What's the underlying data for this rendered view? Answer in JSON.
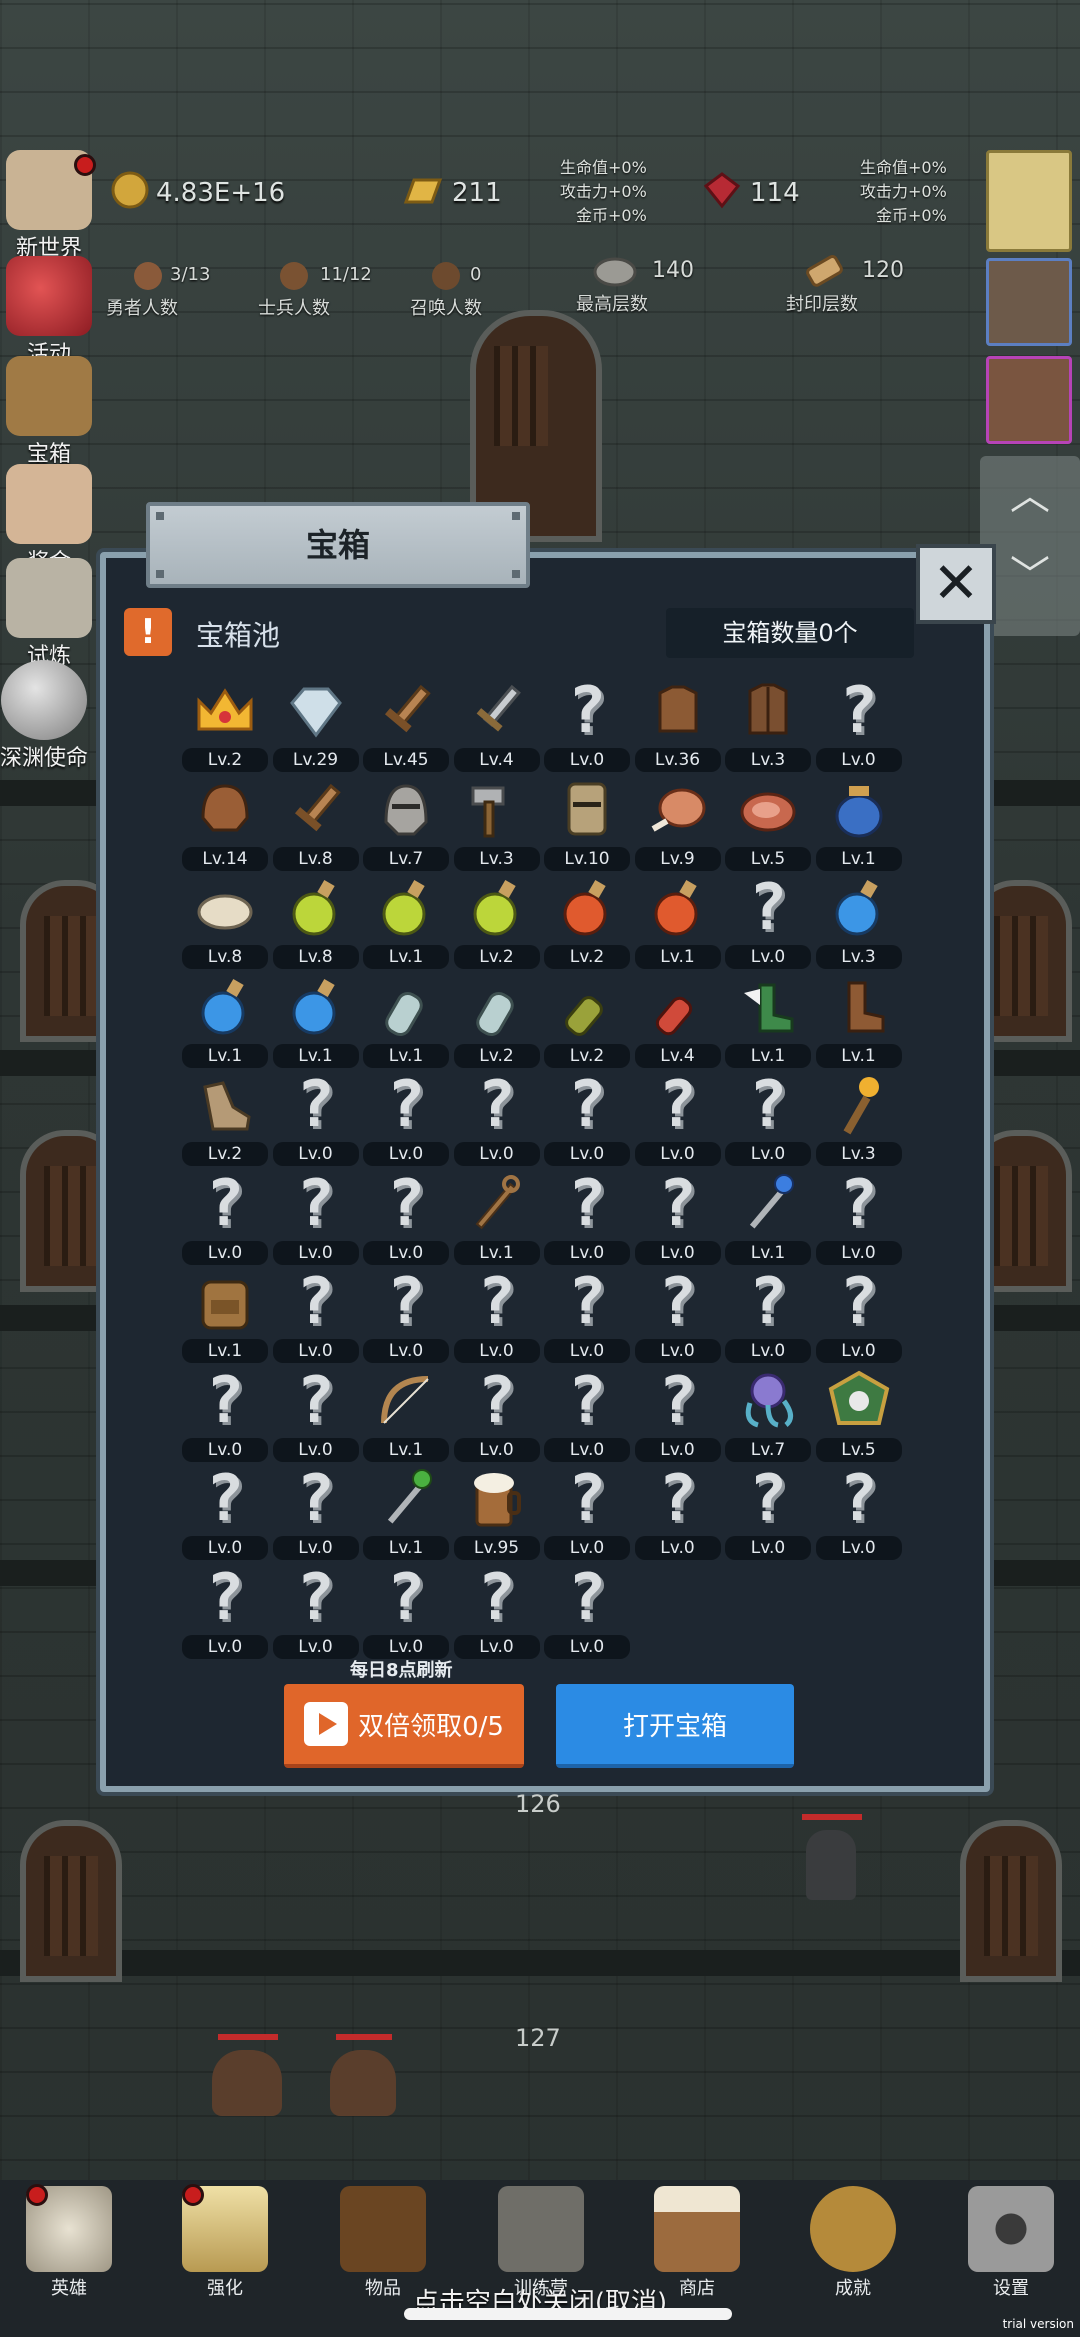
{
  "top": {
    "gold": "4.83E+16",
    "gold_bar": "211",
    "gem": "114",
    "hero_count": "3/13",
    "hero_label": "勇者人数",
    "soldier_count": "11/12",
    "soldier_label": "士兵人数",
    "summon_count": "0",
    "summon_label": "召唤人数",
    "max_floor": "140",
    "max_floor_label": "最高层数",
    "seal_floor": "120",
    "seal_floor_label": "封印层数",
    "bonus_left": [
      "生命值+0%",
      "攻击力+0%",
      "金币+0%"
    ],
    "bonus_right": [
      "生命值+0%",
      "攻击力+0%",
      "金币+0%"
    ]
  },
  "side_menu": [
    "新世界",
    "活动",
    "宝箱",
    "奖金",
    "试炼",
    "深渊使命"
  ],
  "modal": {
    "title": "宝箱",
    "close": "✕",
    "pool_label": "宝箱池",
    "chest_count": "宝箱数量0个",
    "refresh_note": "每日8点刷新",
    "double_button": "双倍领取0/5",
    "open_button": "打开宝箱"
  },
  "items": [
    {
      "icon": "crown",
      "lv": "Lv.2"
    },
    {
      "icon": "diamond",
      "lv": "Lv.29"
    },
    {
      "icon": "wood-sword",
      "lv": "Lv.45"
    },
    {
      "icon": "iron-sword",
      "lv": "Lv.4"
    },
    {
      "icon": "unknown",
      "lv": "Lv.0"
    },
    {
      "icon": "leather-armor",
      "lv": "Lv.36"
    },
    {
      "icon": "vest-armor",
      "lv": "Lv.3"
    },
    {
      "icon": "unknown",
      "lv": "Lv.0"
    },
    {
      "icon": "leather-helmet",
      "lv": "Lv.14"
    },
    {
      "icon": "wood-sword",
      "lv": "Lv.8"
    },
    {
      "icon": "knight-helmet",
      "lv": "Lv.7"
    },
    {
      "icon": "hammer",
      "lv": "Lv.3"
    },
    {
      "icon": "great-helm",
      "lv": "Lv.10"
    },
    {
      "icon": "ham",
      "lv": "Lv.9"
    },
    {
      "icon": "steak",
      "lv": "Lv.5"
    },
    {
      "icon": "potion-jar",
      "lv": "Lv.1"
    },
    {
      "icon": "bun",
      "lv": "Lv.8"
    },
    {
      "icon": "yellow-potion",
      "lv": "Lv.8"
    },
    {
      "icon": "yellow-potion",
      "lv": "Lv.1"
    },
    {
      "icon": "yellow-potion",
      "lv": "Lv.2"
    },
    {
      "icon": "red-potion",
      "lv": "Lv.2"
    },
    {
      "icon": "red-potion",
      "lv": "Lv.1"
    },
    {
      "icon": "unknown",
      "lv": "Lv.0"
    },
    {
      "icon": "blue-potion",
      "lv": "Lv.3"
    },
    {
      "icon": "blue-potion",
      "lv": "Lv.1"
    },
    {
      "icon": "blue-potion",
      "lv": "Lv.1"
    },
    {
      "icon": "gray-potion",
      "lv": "Lv.1"
    },
    {
      "icon": "gray-potion",
      "lv": "Lv.2"
    },
    {
      "icon": "olive-bottle",
      "lv": "Lv.2"
    },
    {
      "icon": "red-bottle",
      "lv": "Lv.4"
    },
    {
      "icon": "winged-boot",
      "lv": "Lv.1"
    },
    {
      "icon": "boot",
      "lv": "Lv.1"
    },
    {
      "icon": "shoe",
      "lv": "Lv.2"
    },
    {
      "icon": "unknown",
      "lv": "Lv.0"
    },
    {
      "icon": "unknown",
      "lv": "Lv.0"
    },
    {
      "icon": "unknown",
      "lv": "Lv.0"
    },
    {
      "icon": "unknown",
      "lv": "Lv.0"
    },
    {
      "icon": "unknown",
      "lv": "Lv.0"
    },
    {
      "icon": "unknown",
      "lv": "Lv.0"
    },
    {
      "icon": "torch",
      "lv": "Lv.3"
    },
    {
      "icon": "unknown",
      "lv": "Lv.0"
    },
    {
      "icon": "unknown",
      "lv": "Lv.0"
    },
    {
      "icon": "unknown",
      "lv": "Lv.0"
    },
    {
      "icon": "wood-staff",
      "lv": "Lv.1"
    },
    {
      "icon": "unknown",
      "lv": "Lv.0"
    },
    {
      "icon": "unknown",
      "lv": "Lv.0"
    },
    {
      "icon": "blue-wand",
      "lv": "Lv.1"
    },
    {
      "icon": "unknown",
      "lv": "Lv.0"
    },
    {
      "icon": "backpack",
      "lv": "Lv.1"
    },
    {
      "icon": "unknown",
      "lv": "Lv.0"
    },
    {
      "icon": "unknown",
      "lv": "Lv.0"
    },
    {
      "icon": "unknown",
      "lv": "Lv.0"
    },
    {
      "icon": "unknown",
      "lv": "Lv.0"
    },
    {
      "icon": "unknown",
      "lv": "Lv.0"
    },
    {
      "icon": "unknown",
      "lv": "Lv.0"
    },
    {
      "icon": "unknown",
      "lv": "Lv.0"
    },
    {
      "icon": "unknown",
      "lv": "Lv.0"
    },
    {
      "icon": "unknown",
      "lv": "Lv.0"
    },
    {
      "icon": "bow",
      "lv": "Lv.1"
    },
    {
      "icon": "unknown",
      "lv": "Lv.0"
    },
    {
      "icon": "unknown",
      "lv": "Lv.0"
    },
    {
      "icon": "unknown",
      "lv": "Lv.0"
    },
    {
      "icon": "tentacle",
      "lv": "Lv.7"
    },
    {
      "icon": "emblem",
      "lv": "Lv.5"
    },
    {
      "icon": "unknown",
      "lv": "Lv.0"
    },
    {
      "icon": "unknown",
      "lv": "Lv.0"
    },
    {
      "icon": "green-wand",
      "lv": "Lv.1"
    },
    {
      "icon": "beer-mug",
      "lv": "Lv.95"
    },
    {
      "icon": "unknown",
      "lv": "Lv.0"
    },
    {
      "icon": "unknown",
      "lv": "Lv.0"
    },
    {
      "icon": "unknown",
      "lv": "Lv.0"
    },
    {
      "icon": "unknown",
      "lv": "Lv.0"
    },
    {
      "icon": "unknown",
      "lv": "Lv.0"
    },
    {
      "icon": "unknown",
      "lv": "Lv.0"
    },
    {
      "icon": "unknown",
      "lv": "Lv.0"
    },
    {
      "icon": "unknown",
      "lv": "Lv.0"
    },
    {
      "icon": "unknown",
      "lv": "Lv.0"
    }
  ],
  "floors": [
    "126",
    "127"
  ],
  "bottom_nav": [
    "英雄",
    "强化",
    "物品",
    "训练营",
    "商店",
    "成就",
    "设置"
  ],
  "close_hint": "点击空白处关闭(取消)",
  "watermark": "trial version"
}
